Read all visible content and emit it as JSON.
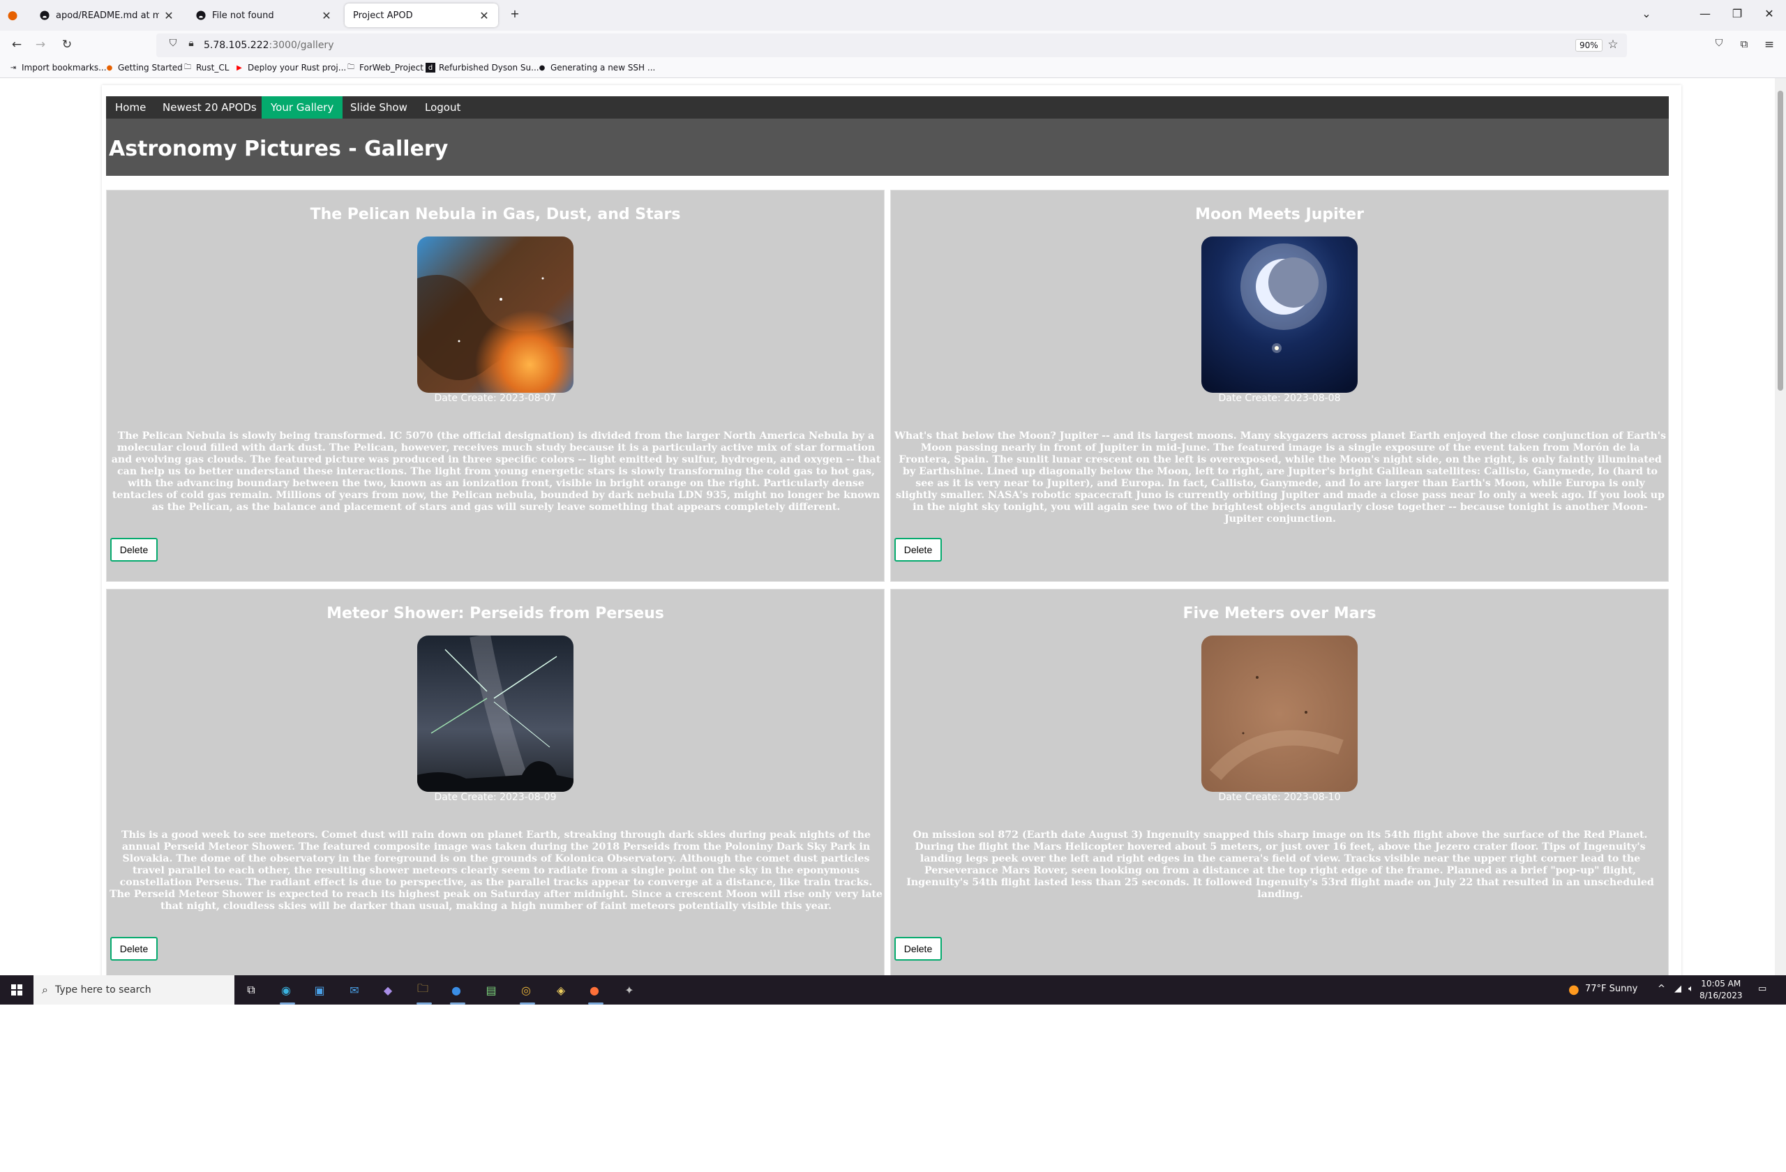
{
  "browser": {
    "tabs": [
      {
        "title": "apod/README.md at main · Hu",
        "active": false
      },
      {
        "title": "File not found",
        "active": false
      },
      {
        "title": "Project APOD",
        "active": true
      }
    ],
    "url_host": "5.78.105.222",
    "url_path": ":3000/gallery",
    "zoom": "90%",
    "bookmarks": [
      "Import bookmarks...",
      "Getting Started",
      "Rust_CL",
      "Deploy your Rust proj...",
      "ForWeb_Project",
      "Refurbished Dyson Su...",
      "Generating a new SSH ..."
    ]
  },
  "menu": {
    "items": [
      "Home",
      "Newest 20 APODs",
      "Your Gallery",
      "Slide Show",
      "Logout"
    ],
    "active": "Your Gallery"
  },
  "page_title": "Astronomy Pictures - Gallery",
  "cards": [
    {
      "title": "The Pelican Nebula in Gas, Dust, and Stars",
      "date": "Date Create: 2023-08-07",
      "description": "The Pelican Nebula is slowly being transformed. IC 5070 (the official designation) is divided from the larger North America Nebula by a molecular cloud filled with dark dust. The Pelican, however, receives much study because it is a particularly active mix of star formation and evolving gas clouds. The featured picture was produced in three specific colors -- light emitted by sulfur, hydrogen, and oxygen -- that can help us to better understand these interactions. The light from young energetic stars is slowly transforming the cold gas to hot gas, with the advancing boundary between the two, known as an ionization front, visible in bright orange on the right. Particularly dense tentacles of cold gas remain. Millions of years from now, the Pelican nebula, bounded by dark nebula LDN 935, might no longer be known as the Pelican, as the balance and placement of stars and gas will surely leave something that appears completely different.",
      "delete_label": "Delete"
    },
    {
      "title": "Moon Meets Jupiter",
      "date": "Date Create: 2023-08-08",
      "description": "What's that below the Moon? Jupiter -- and its largest moons. Many skygazers across planet Earth enjoyed the close conjunction of Earth's Moon passing nearly in front of Jupiter in mid-June. The featured image is a single exposure of the event taken from Morón de la Frontera, Spain. The sunlit lunar crescent on the left is overexposed, while the Moon's night side, on the right, is only faintly illuminated by Earthshine. Lined up diagonally below the Moon, left to right, are Jupiter's bright Galilean satellites: Callisto, Ganymede, Io (hard to see as it is very near to Jupiter), and Europa. In fact, Callisto, Ganymede, and Io are larger than Earth's Moon, while Europa is only slightly smaller. NASA's robotic spacecraft Juno is currently orbiting Jupiter and made a close pass near Io only a week ago. If you look up in the night sky tonight, you will again see two of the brightest objects angularly close together -- because tonight is another Moon-Jupiter conjunction.",
      "delete_label": "Delete"
    },
    {
      "title": "Meteor Shower: Perseids from Perseus",
      "date": "Date Create: 2023-08-09",
      "description": "This is a good week to see meteors. Comet dust will rain down on planet Earth, streaking through dark skies during peak nights of the annual Perseid Meteor Shower. The featured composite image was taken during the 2018 Perseids from the Poloniny Dark Sky Park in Slovakia. The dome of the observatory in the foreground is on the grounds of Kolonica Observatory. Although the comet dust particles travel parallel to each other, the resulting shower meteors clearly seem to radiate from a single point on the sky in the eponymous constellation Perseus. The radiant effect is due to perspective, as the parallel tracks appear to converge at a distance, like train tracks. The Perseid Meteor Shower is expected to reach its highest peak on Saturday after midnight. Since a crescent Moon will rise only very late that night, cloudless skies will be darker than usual, making a high number of faint meteors potentially visible this year.",
      "delete_label": "Delete"
    },
    {
      "title": "Five Meters over Mars",
      "date": "Date Create: 2023-08-10",
      "description": "On mission sol 872 (Earth date August 3) Ingenuity snapped this sharp image on its 54th flight above the surface of the Red Planet. During the flight the Mars Helicopter hovered about 5 meters, or just over 16 feet, above the Jezero crater floor. Tips of Ingenuity's landing legs peek over the left and right edges in the camera's field of view. Tracks visible near the upper right corner lead to the Perseverance Mars Rover, seen looking on from a distance at the top right edge of the frame. Planned as a brief \"pop-up\" flight, Ingenuity's 54th flight lasted less than 25 seconds. It followed Ingenuity's 53rd flight made on July 22 that resulted in an unscheduled landing.",
      "delete_label": "Delete"
    }
  ],
  "taskbar": {
    "search_placeholder": "Type here to search",
    "weather": "77°F  Sunny",
    "time": "10:05 AM",
    "date": "8/16/2023"
  },
  "colors": {
    "menu_bg": "#333333",
    "menu_active": "#04AA6D",
    "header_bg": "#555555",
    "card_bg": "#cccccc"
  }
}
